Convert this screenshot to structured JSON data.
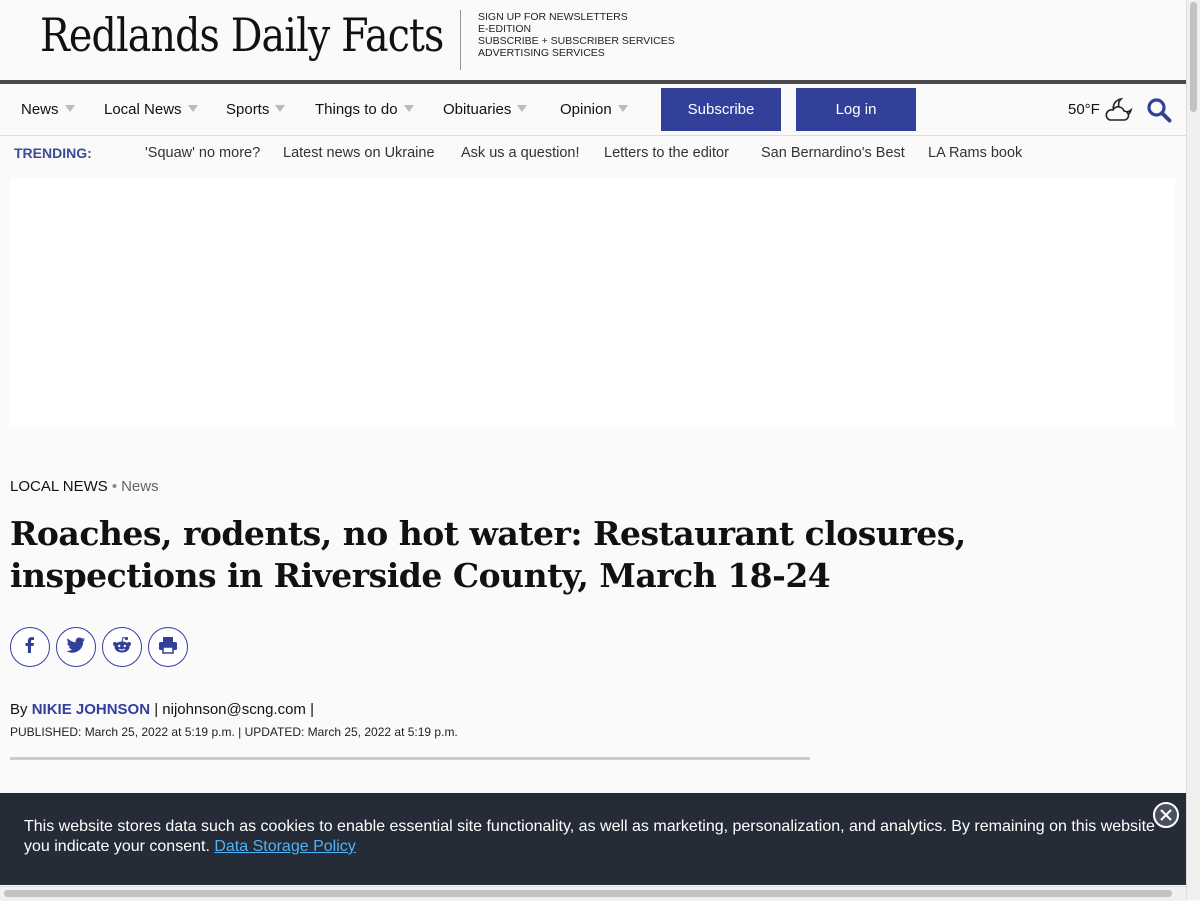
{
  "header": {
    "logo_text": "Redlands Daily Facts",
    "links": [
      "SIGN UP FOR NEWSLETTERS",
      "E-EDITION",
      "SUBSCRIBE + SUBSCRIBER SERVICES",
      "ADVERTISING SERVICES"
    ]
  },
  "nav": {
    "items": [
      "News",
      "Local News",
      "Sports",
      "Things to do",
      "Obituaries",
      "Opinion"
    ],
    "subscribe_label": "Subscribe",
    "login_label": "Log in",
    "weather_temp": "50°F",
    "weather_icon": "partly-cloudy-night-icon",
    "search_icon": "search-icon"
  },
  "trending": {
    "label": "TRENDING:",
    "links": [
      "'Squaw' no more?",
      "Latest news on Ukraine",
      "Ask us a question!",
      "Letters to the editor",
      "San Bernardino's Best",
      "LA Rams book"
    ]
  },
  "article": {
    "section": "LOCAL NEWS",
    "subsection": "News",
    "headline": "Roaches, rodents, no hot water: Restaurant closures, inspections in Riverside County, March 18-24",
    "share_icons": [
      "facebook-icon",
      "twitter-icon",
      "reddit-icon",
      "print-icon"
    ],
    "byline_prefix": "By",
    "author": "NIKIE JOHNSON",
    "separator": "|",
    "email": "nijohnson@scng.com",
    "dates": "PUBLISHED: March 25, 2022 at 5:19 p.m. | UPDATED: March 25, 2022 at 5:19 p.m."
  },
  "cookie_banner": {
    "text": "This website stores data such as cookies to enable essential site functionality, as well as marketing, personalization, and analytics. By remaining on this website you indicate your consent.",
    "link_text": "Data Storage Policy"
  },
  "colors": {
    "brand_blue": "#33409a",
    "trending_blue": "#3c4b94",
    "banner_bg": "#262b38",
    "banner_link": "#4fb3f5"
  }
}
